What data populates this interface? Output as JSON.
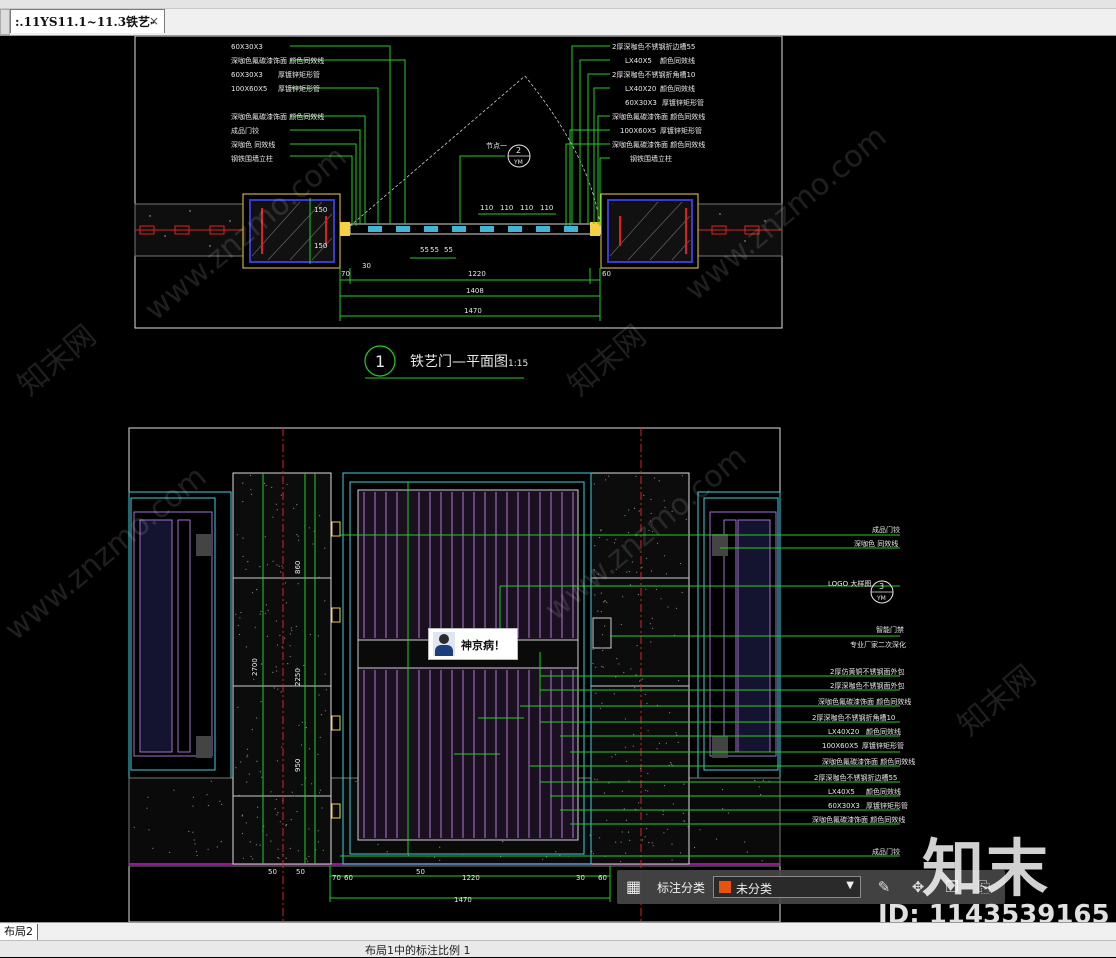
{
  "tabbar": {
    "left_marker": "",
    "active_tab": ":.11YS11.1~11.3铁艺-",
    "close_glyph": "×"
  },
  "drawing": {
    "plan_title_num": "1",
    "plan_title": "铁艺门—平面图",
    "plan_scale": "1:15",
    "plan_labels": [
      "60X30X3",
      "深咖色氟碳漆饰面 颜色同效线",
      "60X30X3",
      "厚镀锌矩形管",
      "100X60X5",
      "厚镀锌矩形管",
      "深咖色氟碳漆饰面 颜色同效线",
      "成品门铰",
      "深咖色 同效线",
      "钢铁围墙立柱",
      "2厚深咖色不锈钢折边槽55",
      "LX40X5",
      "颜色同效线",
      "2厚深咖色不锈钢折角槽10",
      "LX40X20",
      "颜色同效线",
      "60X30X3",
      "厚镀锌矩形管",
      "深咖色氟碳漆饰面 颜色同效线",
      "100X60X5",
      "厚镀锌矩形管",
      "深咖色氟碳漆饰面 颜色同效线",
      "钢铁围墙立柱"
    ],
    "plan_dims": {
      "d1": "1220",
      "d2": "1408",
      "d3": "1470",
      "d4": "60",
      "d5": "70",
      "d6": "30",
      "d7": "110",
      "d8": "110",
      "d9": "110",
      "d10": "110",
      "d11": "55",
      "d12": "55",
      "d13": "55",
      "d14": "150",
      "d15": "150"
    },
    "elev_labels": [
      "成品门铰",
      "深咖色 同效线",
      "LOGO 大样图",
      "智能门禁",
      "专业厂家二次深化",
      "2厚仿黄铜不锈钢面外包",
      "2厚深咖色不锈钢面外包",
      "深咖色氟碳漆饰面 颜色同效线",
      "2厚深咖色不锈钢折角槽10",
      "LX40X20",
      "颜色同效线",
      "100X60X5",
      "厚镀锌矩形管",
      "深咖色氟碳漆饰面 颜色同效线",
      "2厚深咖色不锈钢折边槽55",
      "LX40X5",
      "颜色同效线",
      "60X30X3",
      "厚镀锌矩形管",
      "深咖色氟碳漆饰面 颜色同效线",
      "成品门铰"
    ],
    "elev_dims": {
      "e1": "1220",
      "e2": "1470",
      "e3": "2700",
      "e4": "2250",
      "e5": "950",
      "e6": "860",
      "e7": "50",
      "e8": "50",
      "e9": "70",
      "e10": "60",
      "e11": "30",
      "e12": "60",
      "e13": "50"
    },
    "section_mark_1": {
      "num": "2",
      "sub": "YM"
    },
    "section_mark_2": {
      "num": "3",
      "sub": "YM"
    },
    "section_text_1": "节点一",
    "watermark": "www.znzmo.com",
    "watermark_cn": "知末网"
  },
  "tooltip": {
    "text": "神京病！"
  },
  "annotation_bar": {
    "label": "标注分类",
    "selected": "未分类",
    "swatch_color": "#e8520c"
  },
  "layout_tabs": {
    "tab": "布局2"
  },
  "status": {
    "text": "布局1中的标注比例 1"
  },
  "brand": {
    "logo": "知末",
    "id_text": "ID: 1143539165"
  }
}
